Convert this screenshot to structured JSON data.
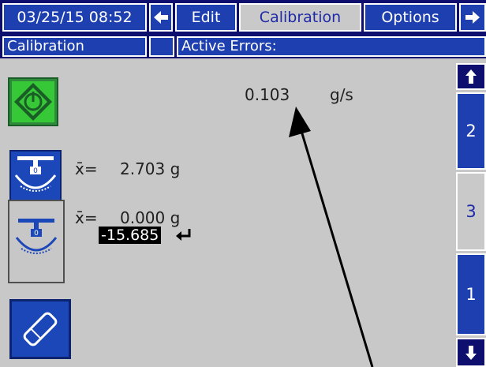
{
  "header": {
    "datetime": "03/25/15 08:52",
    "tabs": [
      {
        "label": "Edit"
      },
      {
        "label": "Calibration"
      },
      {
        "label": "Options"
      }
    ]
  },
  "status_bar": {
    "screen": "Calibration",
    "errors_label": "Active Errors:"
  },
  "main": {
    "flow_value": "0.103",
    "flow_unit": "g/s",
    "weight1": {
      "label": "x̄=",
      "value": "2.703 g"
    },
    "weight2": {
      "label": "x̄=",
      "value": "0.000 g"
    },
    "entry_value": "-15.685",
    "scale_digit": "0"
  },
  "sidebar": {
    "pages": [
      {
        "label": "2"
      },
      {
        "label": "3"
      },
      {
        "label": "1"
      }
    ]
  },
  "colors": {
    "tab_bar": "#0e0e6e",
    "tab_button": "#1e3fb0",
    "tab_selected": "#c9c9c9",
    "start_button": "#2f8a3b",
    "screen_bg": "#c8c8c8"
  },
  "icons": {
    "start": "start-icon",
    "scale": "scale-icon",
    "erase": "eraser-icon",
    "enter": "enter-arrow-icon",
    "back": "left-arrow-icon",
    "forward": "right-arrow-icon",
    "up": "up-arrow-icon",
    "down": "down-arrow-icon"
  }
}
